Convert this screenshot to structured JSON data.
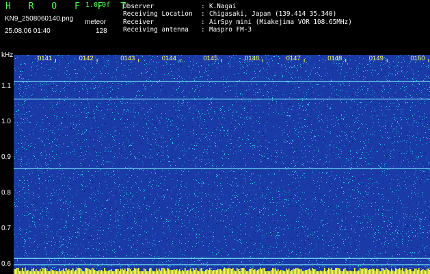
{
  "header": {
    "app_title": "H R O F F T",
    "version": "1.0.0f",
    "file_name": "KN9_2508060140.png",
    "mode": "meteor",
    "date_time": "25.08.06 01:40",
    "count": "128"
  },
  "info": [
    {
      "label": "Observer",
      "value": "K.Nagai"
    },
    {
      "label": "Receiving Location",
      "value": "Chigasaki, Japan (139.414 35.340)"
    },
    {
      "label": "Receiver",
      "value": "AirSpy mini (Miakejima VOR 108.65MHz)"
    },
    {
      "label": "Receiving antenna",
      "value": "Maspro FM-3"
    }
  ],
  "waterfall": {
    "y_unit": "kHz",
    "y_ticks": [
      "1.1",
      "1.0",
      "0.9",
      "0.8",
      "0.7",
      "0.6"
    ],
    "y_tick_values": [
      1.1,
      1.0,
      0.9,
      0.8,
      0.7,
      0.6
    ],
    "x_ticks": [
      "0141",
      "0142",
      "0143",
      "0144",
      "0145",
      "0146",
      "0147",
      "0148",
      "0149",
      "0150"
    ],
    "y_range": [
      0.575,
      1.19
    ],
    "background_color": "#1a3aa8",
    "noise_color": "#2ad0e6",
    "line_color": "#7ff5ff",
    "bottom_strip_color": "#ffff33",
    "carrier_lines_khz": [
      1.117,
      1.067,
      0.872,
      0.62,
      0.602
    ]
  }
}
